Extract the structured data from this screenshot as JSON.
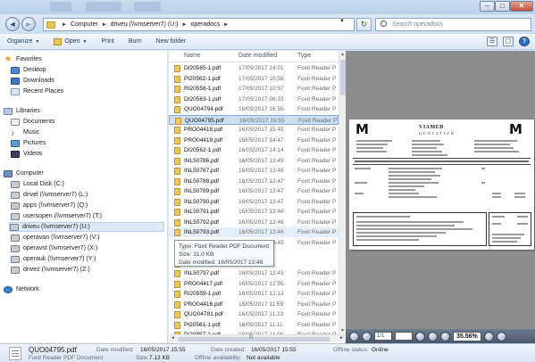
{
  "window": {
    "minimize": "–",
    "maximize": "□",
    "close": "✕"
  },
  "address": {
    "back": "◄",
    "forward": "►",
    "crumbs": [
      "Computer",
      "driveu (\\\\vmserver7) (U:)",
      "operadocs"
    ],
    "search_placeholder": "Search operadocs",
    "refresh": "↻"
  },
  "toolbar": {
    "organize": "Organize",
    "open": "Open",
    "print": "Print",
    "burn": "Burn",
    "new_folder": "New folder"
  },
  "nav": {
    "favorites": "Favorites",
    "desktop": "Desktop",
    "downloads": "Downloads",
    "recent": "Recent Places",
    "libraries": "Libraries",
    "documents": "Documents",
    "music": "Music",
    "pictures": "Pictures",
    "videos": "Videos",
    "computer": "Computer",
    "local_disk": "Local Disk (C:)",
    "drivel": "drivel (\\\\vmserver7) (L:)",
    "apps": "apps (\\\\vmserver7) (Q:)",
    "usersopen": "usersopen (\\\\vmserver7) (T:)",
    "driveu": "driveu (\\\\vmserver7) (U:)",
    "operavan": "operavan (\\\\vmserver7) (V:)",
    "operavst": "operavst (\\\\vmserver7) (X:)",
    "operauk": "operauk (\\\\vmserver7) (Y:)",
    "drivez": "drivez (\\\\vmserver7) (Z:)",
    "network": "Network"
  },
  "columns": {
    "name": "Name",
    "date": "Date modified",
    "type": "Type"
  },
  "files": [
    {
      "name": "DI20565-1.pdf",
      "date": "17/05/2017 14:01",
      "type": "Foxit Reader P"
    },
    {
      "name": "PI20562-1.pdf",
      "date": "17/05/2017 10:58",
      "type": "Foxit Reader P"
    },
    {
      "name": "RI20558-1.pdf",
      "date": "17/05/2017 10:57",
      "type": "Foxit Reader P"
    },
    {
      "name": "DI20563-1.pdf",
      "date": "17/05/2017 08:33",
      "type": "Foxit Reader P"
    },
    {
      "name": "QUO04794.pdf",
      "date": "16/05/2017 16:55",
      "type": "Foxit Reader P"
    },
    {
      "name": "QUO04795.pdf",
      "date": "16/05/2017 15:55",
      "type": "Foxit Reader P"
    },
    {
      "name": "PRO04418.pdf",
      "date": "16/05/2017 15:45",
      "type": "Foxit Reader P"
    },
    {
      "name": "PRO04419.pdf",
      "date": "16/05/2017 14:47",
      "type": "Foxit Reader P"
    },
    {
      "name": "DI20562-1.pdf",
      "date": "16/05/2017 14:14",
      "type": "Foxit Reader P"
    },
    {
      "name": "INL50786.pdf",
      "date": "16/05/2017 13:49",
      "type": "Foxit Reader P"
    },
    {
      "name": "INL50787.pdf",
      "date": "16/05/2017 13:48",
      "type": "Foxit Reader P"
    },
    {
      "name": "INL50788.pdf",
      "date": "16/05/2017 13:47",
      "type": "Foxit Reader P"
    },
    {
      "name": "INL50789.pdf",
      "date": "16/05/2017 13:47",
      "type": "Foxit Reader P"
    },
    {
      "name": "INL50790.pdf",
      "date": "16/05/2017 13:47",
      "type": "Foxit Reader P"
    },
    {
      "name": "INL50791.pdf",
      "date": "16/05/2017 13:46",
      "type": "Foxit Reader P"
    },
    {
      "name": "INL50792.pdf",
      "date": "16/05/2017 13:46",
      "type": "Foxit Reader P"
    },
    {
      "name": "INL50793.pdf",
      "date": "16/05/2017 13:46",
      "type": "Foxit Reader P"
    },
    {
      "name": "INL50794.pdf",
      "date": "16/05/2017 13:45",
      "type": "Foxit Reader P"
    },
    {
      "name": "IN",
      "date": "",
      "type": ""
    },
    {
      "name": "IN",
      "date": "",
      "type": ""
    },
    {
      "name": "INL50797.pdf",
      "date": "16/05/2017 13:43",
      "type": "Foxit Reader P"
    },
    {
      "name": "PRO04417.pdf",
      "date": "16/05/2017 12:55",
      "type": "Foxit Reader P"
    },
    {
      "name": "RI20559-1.pdf",
      "date": "16/05/2017 12:13",
      "type": "Foxit Reader P"
    },
    {
      "name": "PRO04416.pdf",
      "date": "16/05/2017 11:59",
      "type": "Foxit Reader P"
    },
    {
      "name": "QUO04781.pdf",
      "date": "16/05/2017 11:23",
      "type": "Foxit Reader P"
    },
    {
      "name": "PI20561-1.pdf",
      "date": "16/05/2017 11:11",
      "type": "Foxit Reader P"
    },
    {
      "name": "PI20557-1.pdf",
      "date": "16/05/2017 11:06",
      "type": "Foxit Reader P"
    }
  ],
  "tooltip": {
    "type": "Type: Foxit Reader PDF Document",
    "size": "Size: 31.0 KB",
    "date": "Date modified: 16/05/2017 13:46"
  },
  "pdf": {
    "company": "VIAMED",
    "doc": "QUOTATION",
    "logo": "M",
    "page": "1/1",
    "zoom": "35.56%"
  },
  "details": {
    "filename": "QUO04795.pdf",
    "filetype": "Foxit Reader PDF Document",
    "modified_label": "Date modified:",
    "modified": "16/05/2017 15:55",
    "size_label": "Size:",
    "size": "7.13 KB",
    "created_label": "Date created:",
    "created": "16/05/2017 15:55",
    "avail_label": "Offline availability:",
    "avail": "Not available",
    "offline_label": "Offline status:",
    "offline": "Online"
  },
  "colors": {
    "selection": "#cce0f7",
    "preview_bg": "#8d8d8d",
    "folder": "#f0c85a"
  }
}
